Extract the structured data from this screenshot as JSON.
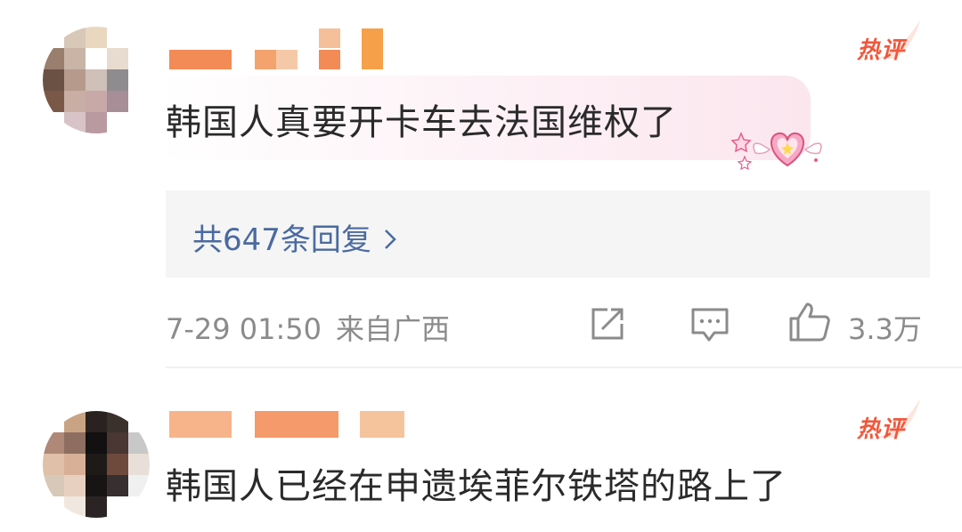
{
  "comments": [
    {
      "hot_label": "热评",
      "text": "韩国人真要开卡车去法国维权了",
      "replies_label": "共647条回复",
      "timestamp": "7-29 01:50",
      "region": "来自广西",
      "like_count": "3.3万",
      "icons": [
        "share-icon",
        "comment-icon",
        "like-icon"
      ],
      "avatar_colors": [
        [
          "#ffffff",
          "#d8c8b8",
          "#e9d7c0",
          "#ffffff",
          "#ffffff"
        ],
        [
          "#9a7e6e",
          "#c9b4a6",
          "#ffffff",
          "#e8dcd0",
          "#ffffff"
        ],
        [
          "#6b5044",
          "#b69a8c",
          "#cfc0b8",
          "#8e8c8f",
          "#ffffff"
        ],
        [
          "#7a5848",
          "#c8aea4",
          "#c9a8a8",
          "#a88e96",
          "#ffffff"
        ],
        [
          "#ffffff",
          "#d8c4c8",
          "#b89aa0",
          "#ffffff",
          "#ffffff"
        ]
      ],
      "name_mask_colors": [
        "#f28b56",
        "#f4a36e",
        "#f5c9a8",
        "#f5c099",
        "#f7a04a"
      ]
    },
    {
      "hot_label": "热评",
      "text": "韩国人已经在申遗埃菲尔铁塔的路上了",
      "icons": [
        "hot-swoosh-icon"
      ],
      "avatar_colors": [
        [
          "#ffffff",
          "#c9a484",
          "#2a2220",
          "#3a302c",
          "#ffffff"
        ],
        [
          "#b08878",
          "#8e6e60",
          "#121010",
          "#4a3632",
          "#c8c8c8"
        ],
        [
          "#e0c0a8",
          "#d8b098",
          "#1e1a18",
          "#6e4a3c",
          "#e8e0d8"
        ],
        [
          "#d8c8b8",
          "#e8d0c0",
          "#181414",
          "#383030",
          "#f0f0f0"
        ],
        [
          "#ffffff",
          "#f0e8e0",
          "#2c2424",
          "#ffffff",
          "#ffffff"
        ]
      ],
      "name_mask_colors": [
        "#f7b48a",
        "#f59a6a",
        "#f5c49c"
      ]
    }
  ],
  "colors": {
    "hot_badge": "#f0583c",
    "link": "#4a6aa0",
    "meta": "#8b8b8b",
    "text": "#2a2a2a"
  }
}
